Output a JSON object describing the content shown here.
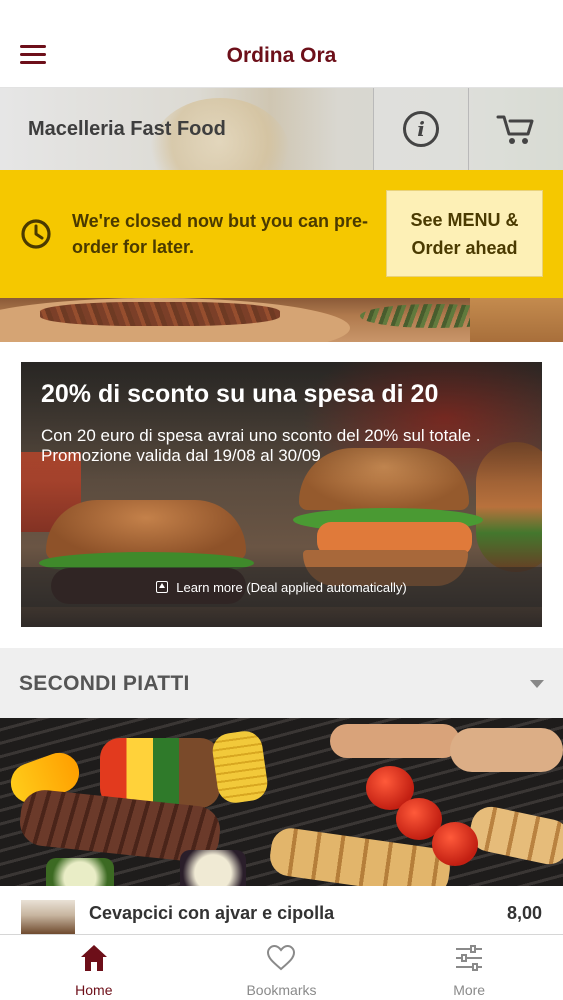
{
  "header": {
    "title": "Ordina Ora"
  },
  "restaurant": {
    "name": "Macelleria Fast Food",
    "info_icon": "info-icon",
    "cart_icon": "cart-icon"
  },
  "closed_banner": {
    "message": "We're closed now but you can pre-order for later.",
    "button_label": "See MENU & Order ahead",
    "icon": "clock-icon",
    "color": "#f5c800"
  },
  "promo": {
    "title": "20% di sconto su una spesa di 20",
    "description": "Con 20 euro di spesa avrai uno sconto del 20% sul totale . Promozione valida dal 19/08 al 30/09",
    "link_label": "Learn more (Deal applied automatically)"
  },
  "category": {
    "title": "SECONDI PIATTI"
  },
  "menu_items": [
    {
      "name": "Cevapcici con ajvar e cipolla",
      "price": "8,00"
    }
  ],
  "tabs": [
    {
      "label": "Home",
      "icon": "home-icon",
      "active": true
    },
    {
      "label": "Bookmarks",
      "icon": "heart-icon",
      "active": false
    },
    {
      "label": "More",
      "icon": "sliders-icon",
      "active": false
    }
  ],
  "colors": {
    "brand": "#6d0f19",
    "banner": "#f5c800",
    "banner_button": "#fdf0b6"
  }
}
